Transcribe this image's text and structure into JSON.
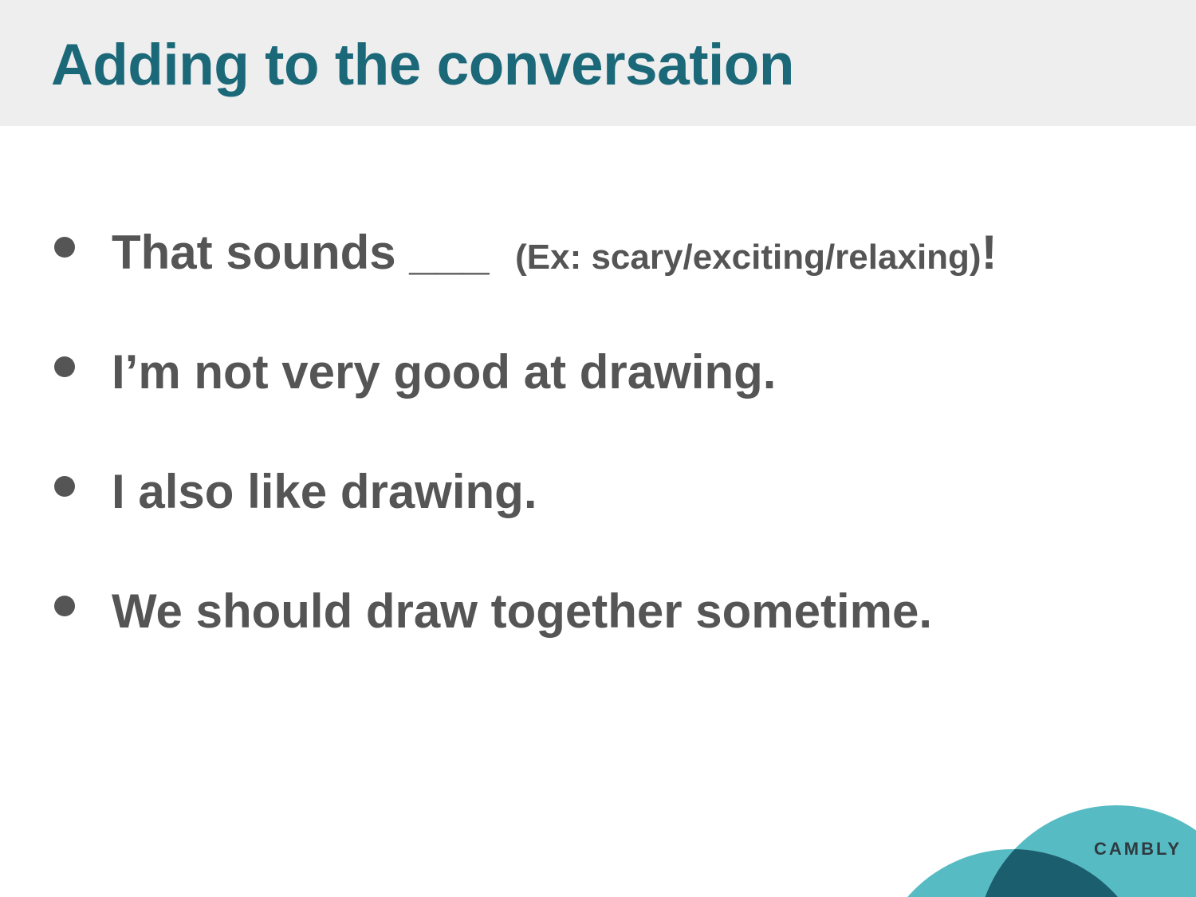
{
  "title": "Adding to the conversation",
  "bullets": [
    {
      "main": "That sounds ___ ",
      "note": "(Ex: scary/exciting/relaxing)",
      "end": "!"
    },
    {
      "main": "I’m not very good at drawing."
    },
    {
      "main": "I also like drawing."
    },
    {
      "main": "We should draw together sometime."
    }
  ],
  "brand": "CAMBLY",
  "colors": {
    "title": "#1b6879",
    "text": "#555555",
    "header_bg": "#eeeeee",
    "logo_light": "#57bbc3",
    "logo_dark": "#1b5e6e"
  }
}
